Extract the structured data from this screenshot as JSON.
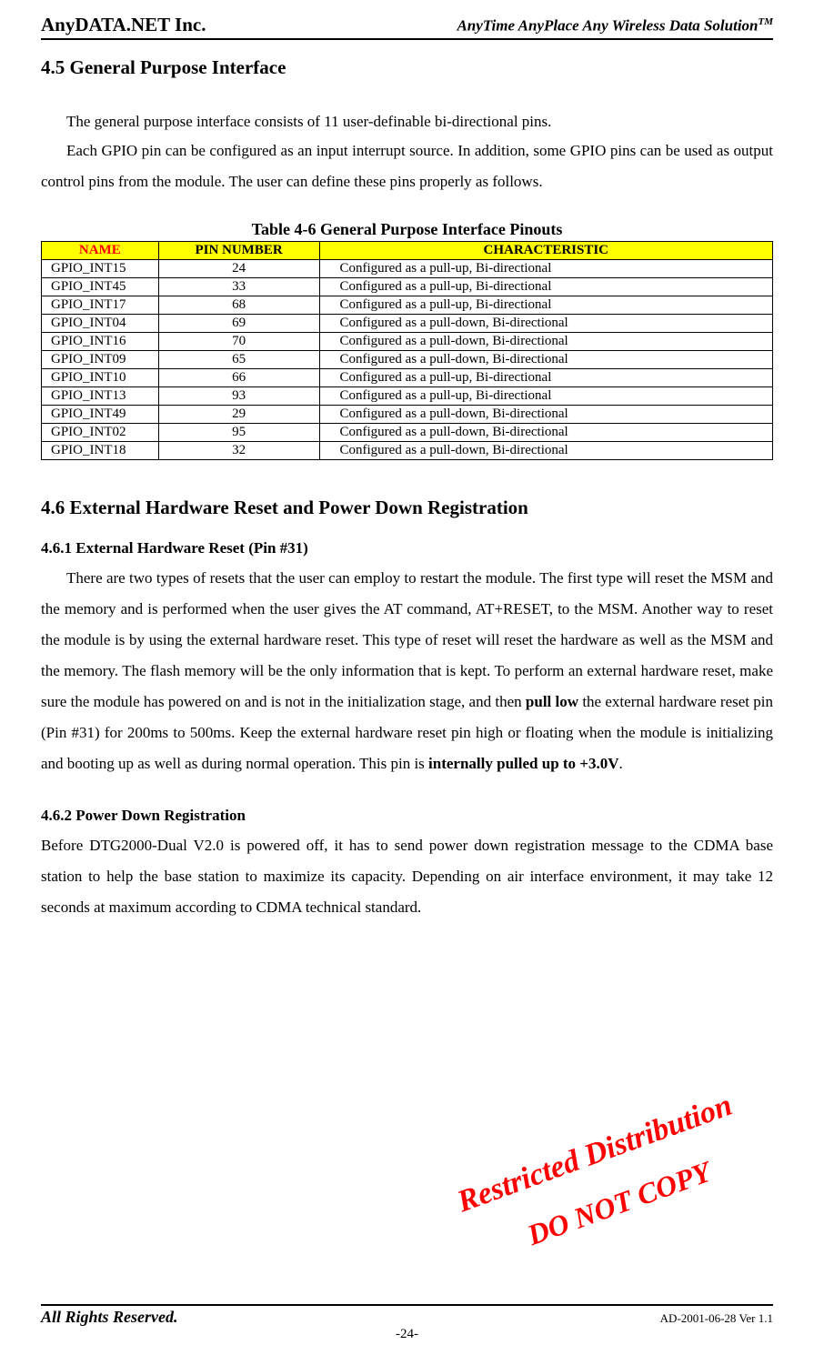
{
  "header": {
    "company": "AnyDATA.NET Inc.",
    "tagline_text": "AnyTime AnyPlace Any Wireless Data Solution",
    "tagline_tm": "TM"
  },
  "section45": {
    "title": "4.5 General Purpose Interface",
    "para1": "The general purpose interface consists of 11 user-definable bi-directional pins.",
    "para2": "Each GPIO pin can be configured as an input interrupt source. In addition, some GPIO pins can be used as output control pins from the module. The user can define these pins properly as follows."
  },
  "table46": {
    "caption": "Table 4-6 General Purpose Interface Pinouts",
    "headers": {
      "name": "NAME",
      "pin": "PIN NUMBER",
      "char": "CHARACTERISTIC"
    },
    "rows": [
      {
        "name": "GPIO_INT15",
        "pin": "24",
        "char": "Configured as a pull-up, Bi-directional"
      },
      {
        "name": "GPIO_INT45",
        "pin": "33",
        "char": "Configured as a pull-up, Bi-directional"
      },
      {
        "name": "GPIO_INT17",
        "pin": "68",
        "char": "Configured as a pull-up, Bi-directional"
      },
      {
        "name": "GPIO_INT04",
        "pin": "69",
        "char": "Configured as a pull-down, Bi-directional"
      },
      {
        "name": "GPIO_INT16",
        "pin": "70",
        "char": "Configured as a pull-down, Bi-directional"
      },
      {
        "name": "GPIO_INT09",
        "pin": "65",
        "char": "Configured as a pull-down, Bi-directional"
      },
      {
        "name": "GPIO_INT10",
        "pin": "66",
        "char": "Configured as a pull-up, Bi-directional"
      },
      {
        "name": "GPIO_INT13",
        "pin": "93",
        "char": "Configured as a pull-up, Bi-directional"
      },
      {
        "name": "GPIO_INT49",
        "pin": "29",
        "char": "Configured as a pull-down, Bi-directional"
      },
      {
        "name": "GPIO_INT02",
        "pin": "95",
        "char": "Configured as a pull-down, Bi-directional"
      },
      {
        "name": "GPIO_INT18",
        "pin": "32",
        "char": "Configured as a pull-down, Bi-directional"
      }
    ]
  },
  "section46": {
    "title": "4.6 External Hardware Reset and Power Down Registration",
    "sub1_title": "4.6.1 External Hardware Reset (Pin #31)",
    "sub1_para_a": "There are two types of resets that the user can employ to restart the module. The first type will reset the MSM and the memory and is performed when the user gives the AT command, AT+RESET, to the MSM. Another way to reset the module is by using the external hardware reset. This type of reset will reset the hardware as well as the MSM and the memory. The flash memory will be the only information that is kept. To perform an external hardware reset, make sure the module has powered on and is not in the initialization stage, and then ",
    "sub1_bold1": "pull low",
    "sub1_para_b": " the external hardware reset pin (Pin #31) for 200ms to 500ms. Keep the external hardware reset pin high or floating when the module is initializing and booting up as well as during normal operation. This pin is ",
    "sub1_bold2": "internally pulled up to +3.0V",
    "sub1_para_c": ".",
    "sub2_title": "4.6.2 Power Down Registration",
    "sub2_para": "Before DTG2000-Dual V2.0 is powered off, it has to send power down registration message to the CDMA           base station to help the base station to maximize its capacity.    Depending on air interface environment, it may take 12 seconds at maximum according to CDMA technical standard."
  },
  "watermarks": {
    "w1": "Restricted Distribution",
    "w2": "DO NOT COPY"
  },
  "footer": {
    "rights": "All Rights Reserved.",
    "ver": "AD-2001-06-28 Ver 1.1",
    "page": "-24-"
  }
}
